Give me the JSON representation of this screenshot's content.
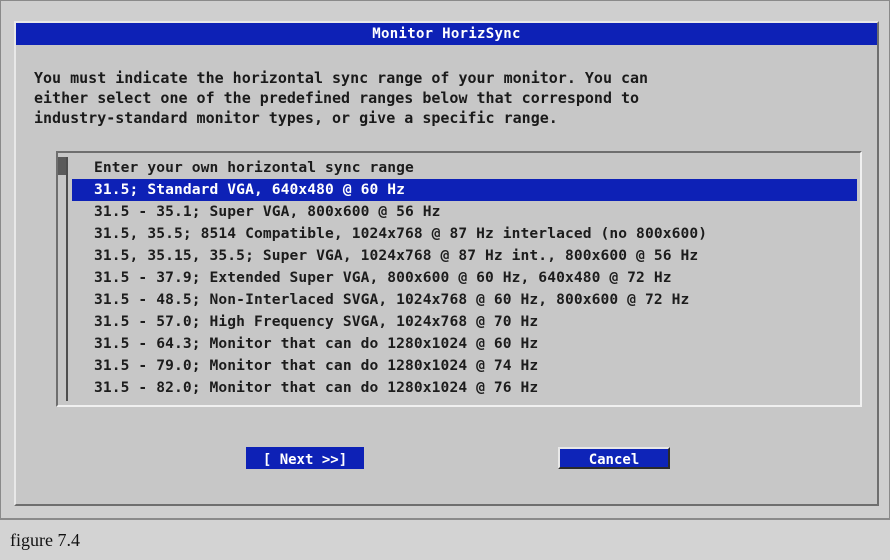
{
  "dialog": {
    "title": "Monitor HorizSync",
    "description": "You must indicate the horizontal sync range of your monitor. You can\neither select one of the predefined ranges below that correspond to\nindustry-standard monitor types, or give a specific range."
  },
  "list": {
    "items": [
      "Enter your own horizontal sync range",
      "31.5; Standard VGA, 640x480 @ 60 Hz",
      "31.5 - 35.1; Super VGA, 800x600 @ 56 Hz",
      "31.5, 35.5; 8514 Compatible, 1024x768 @ 87 Hz interlaced (no 800x600)",
      "31.5, 35.15, 35.5; Super VGA, 1024x768 @ 87 Hz int., 800x600 @ 56 Hz",
      "31.5 - 37.9; Extended Super VGA, 800x600 @ 60 Hz, 640x480 @ 72 Hz",
      "31.5 - 48.5; Non-Interlaced SVGA, 1024x768 @ 60 Hz, 800x600 @ 72 Hz",
      "31.5 - 57.0; High Frequency SVGA, 1024x768 @ 70 Hz",
      "31.5 - 64.3; Monitor that can do 1280x1024 @ 60 Hz",
      "31.5 - 79.0; Monitor that can do 1280x1024 @ 74 Hz",
      "31.5 - 82.0; Monitor that can do 1280x1024 @ 76 Hz"
    ],
    "selected_index": 1
  },
  "buttons": {
    "next_label": "[ Next >>]",
    "cancel_label": "Cancel"
  },
  "caption": "figure 7.4",
  "colors": {
    "accent_blue": "#0d21b6",
    "dialog_gray": "#c7c7c7"
  }
}
